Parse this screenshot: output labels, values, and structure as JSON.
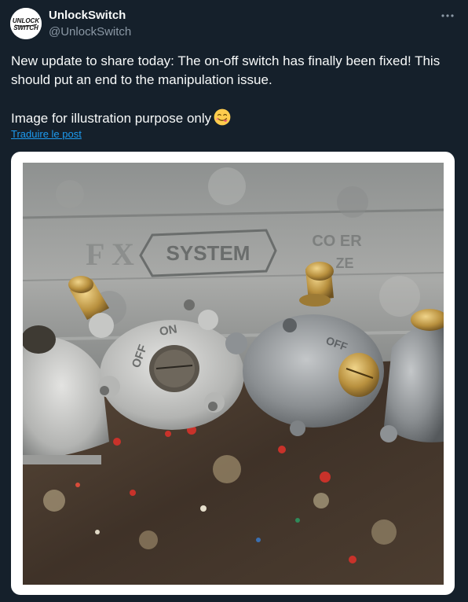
{
  "author": {
    "display_name": "UnlockSwitch",
    "handle": "@UnlockSwitch",
    "avatar_text_line1": "UNLOCK",
    "avatar_text_line2": "SWITCH"
  },
  "tweet": {
    "text_line1": "New update to share today: The on-off switch has finally been fixed! This should put an end to the manipulation issue.",
    "text_line2": "Image for illustration purpose only",
    "emoji": "face-savoring-food-emoji",
    "translate_link": "Traduire le post"
  },
  "media": {
    "photo_lettering_box": "SYSTEM",
    "photo_lettering_box2": "CO... ...CE",
    "switch_label_off": "OFF",
    "switch_label_on": "ON",
    "switch_label_off2": "OFF"
  },
  "icons": {
    "more": "more-options-icon"
  },
  "colors": {
    "background": "#15202b",
    "text_primary": "#f7f9f9",
    "text_secondary": "#8b98a5",
    "link": "#1d9bf0"
  }
}
